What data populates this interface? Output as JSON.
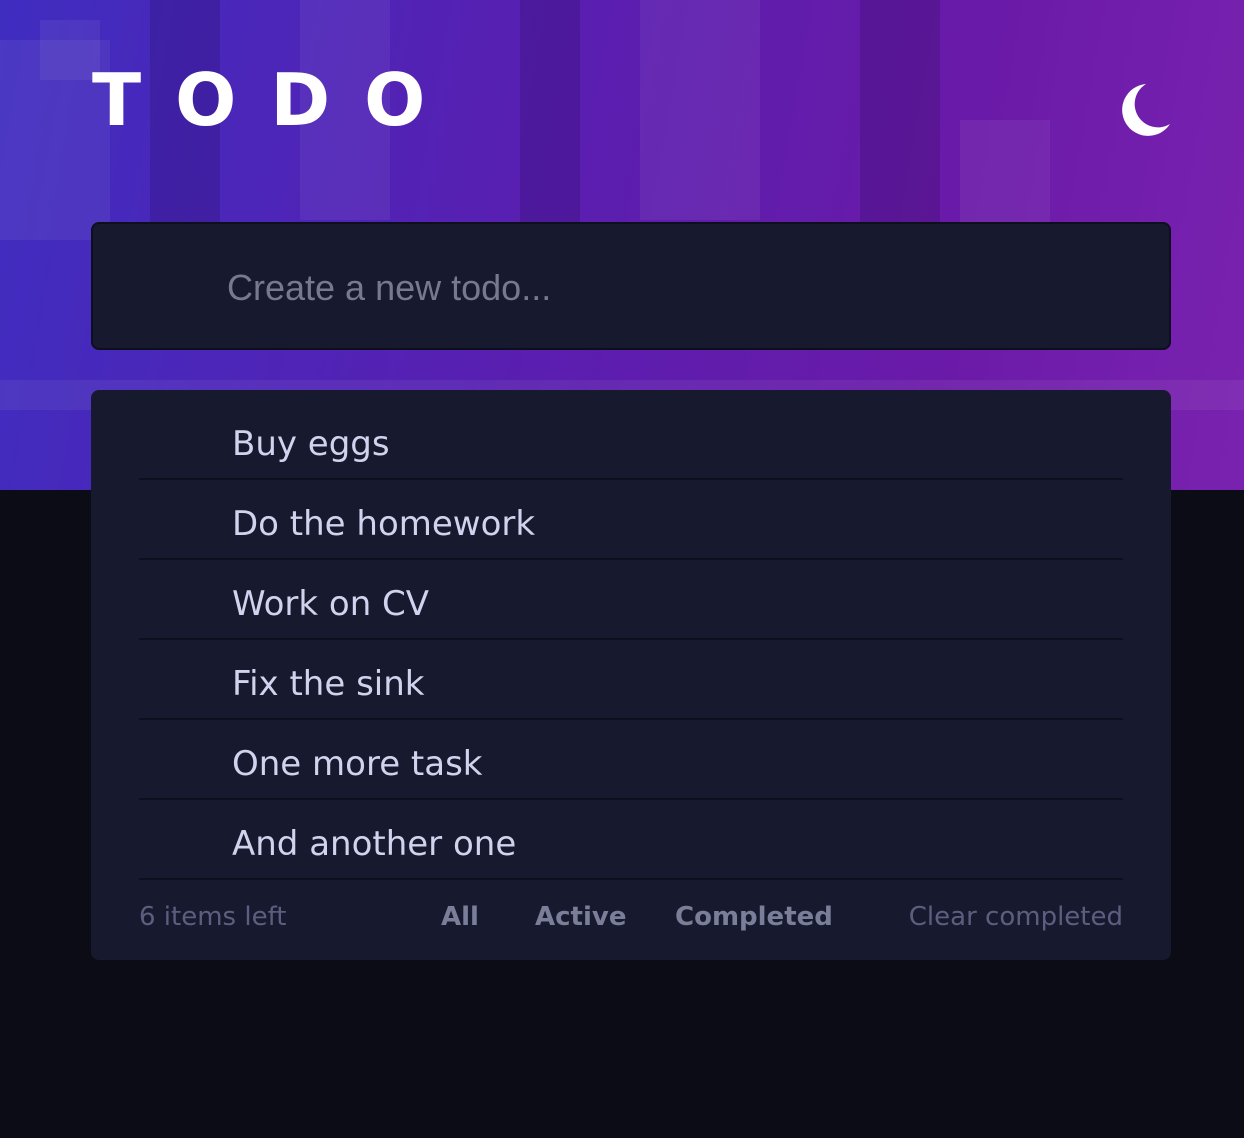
{
  "header": {
    "title": "TODO",
    "theme_icon": "moon-icon"
  },
  "new_todo": {
    "placeholder": "Create a new todo...",
    "value": ""
  },
  "todos": [
    {
      "text": "Buy eggs"
    },
    {
      "text": "Do the homework"
    },
    {
      "text": "Work on CV"
    },
    {
      "text": "Fix the sink"
    },
    {
      "text": "One more task"
    },
    {
      "text": "And another one"
    }
  ],
  "footer": {
    "items_left": "6 items left",
    "filters": {
      "all": "All",
      "active": "Active",
      "completed": "Completed"
    },
    "clear_completed": "Clear completed"
  },
  "colors": {
    "background": "#0b0c15",
    "card": "#171a2e",
    "gradient_start": "#3f2dc0",
    "gradient_end": "#7a22b0",
    "text": "#d1d3ee",
    "muted": "#5b5e7e"
  }
}
